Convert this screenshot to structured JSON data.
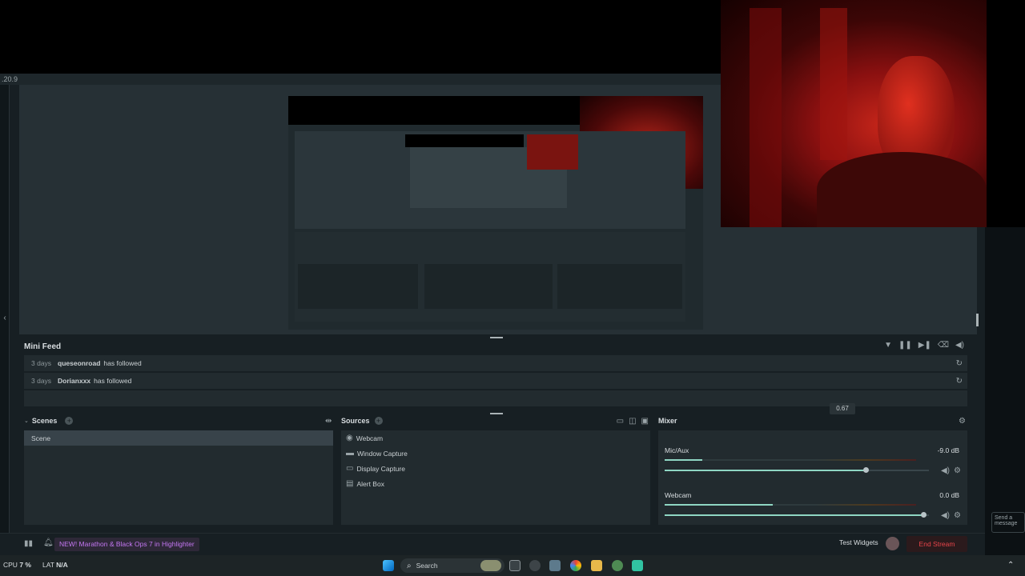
{
  "app": {
    "version_fragment": ".20.9"
  },
  "mini_feed": {
    "title": "Mini Feed",
    "items": [
      {
        "age": "3 days",
        "user": "queseonroad",
        "action": "has followed"
      },
      {
        "age": "3 days",
        "user": "Dorianxxx",
        "action": "has followed"
      }
    ]
  },
  "tooltip_value": "0.67",
  "scenes": {
    "title": "Scenes",
    "items": [
      "Scene"
    ]
  },
  "sources": {
    "title": "Sources",
    "items": [
      "Webcam",
      "Window Capture",
      "Display Capture",
      "Alert Box"
    ]
  },
  "mixer": {
    "title": "Mixer",
    "channels": [
      {
        "name": "Mic/Aux",
        "db": "-9.0 dB",
        "level": 0.15,
        "volume": 0.76
      },
      {
        "name": "Webcam",
        "db": "0.0 dB",
        "level": 0.43,
        "volume": 0.98
      }
    ]
  },
  "footer": {
    "promo": "NEW! Marathon & Black Ops 7 in Highlighter",
    "test_widgets": "Test Widgets",
    "end_stream": "End Stream"
  },
  "stats": {
    "cpu_label": "CPU",
    "cpu_value": "7 %",
    "lat_label": "LAT",
    "lat_value": "N/A"
  },
  "taskbar": {
    "search_placeholder": "Search"
  },
  "chat_hint": "Send a message",
  "colors": {
    "accent": "#31c3a2",
    "end_stream": "#e8444a",
    "promo_text": "#c477f2",
    "meter": "#8fd6c3"
  }
}
